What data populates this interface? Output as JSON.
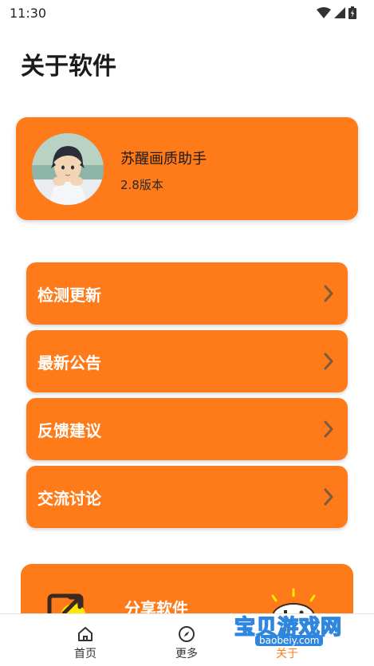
{
  "status_bar": {
    "time": "11:30",
    "icons": [
      "wifi-icon",
      "signal-icon",
      "battery-icon"
    ]
  },
  "page": {
    "title": "关于软件"
  },
  "app": {
    "name": "苏醒画质助手",
    "version": "2.8版本",
    "avatar": "avatar-anime-boy"
  },
  "menu": [
    {
      "label": "检测更新",
      "icon": "chevron-right-icon"
    },
    {
      "label": "最新公告",
      "icon": "chevron-right-icon"
    },
    {
      "label": "反馈建议",
      "icon": "chevron-right-icon"
    },
    {
      "label": "交流讨论",
      "icon": "chevron-right-icon"
    }
  ],
  "share": {
    "label": "分享软件",
    "icon": "share-icon",
    "decoration": "gamepad-icon"
  },
  "bottom_nav": {
    "items": [
      {
        "label": "首页",
        "icon": "home-icon"
      },
      {
        "label": "更多",
        "icon": "compass-icon"
      },
      {
        "label": "关于",
        "icon": "info-icon"
      }
    ]
  },
  "watermark": {
    "text": "宝贝游戏网",
    "url": "baobeiy.com"
  },
  "colors": {
    "accent": "#ff7b1a",
    "text_dark": "#1a1a1a",
    "white": "#ffffff",
    "chevron": "#7a5a40"
  }
}
